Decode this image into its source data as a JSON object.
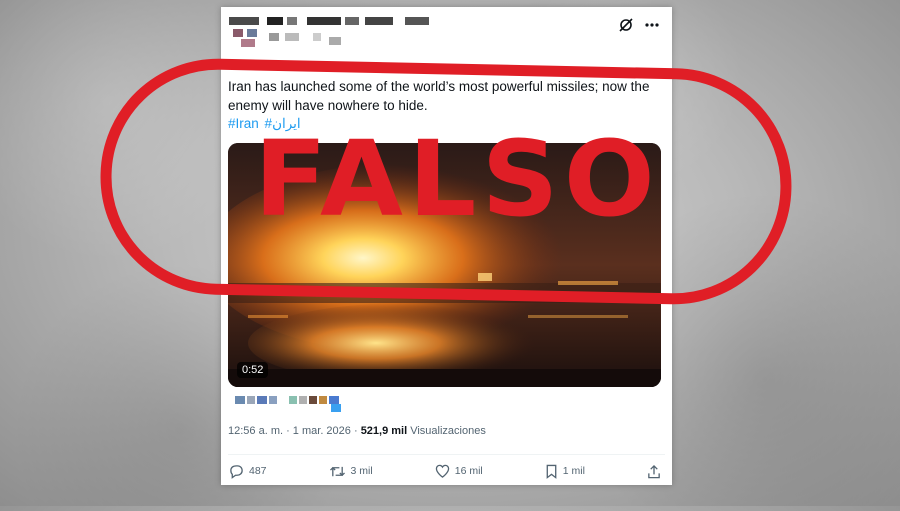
{
  "tweet": {
    "text": "Iran has launched some of the world’s most powerful missiles; now the enemy will have nowhere to hide.",
    "hashtags": [
      "#Iran",
      "#ایران"
    ],
    "video_duration": "0:52",
    "timestamp": "12:56 a. m. · 1 mar. 2026 · ",
    "views_count": "521,9 mil",
    "views_label": " Visualizaciones"
  },
  "actions": {
    "replies": "487",
    "reposts": "3 mil",
    "likes": "16 mil",
    "bookmarks": "1 mil"
  },
  "overlay": {
    "stamp_text": "FALSO",
    "stamp_color": "#e01e26"
  },
  "icons": [
    "grok-icon",
    "more-icon",
    "reply-icon",
    "repost-icon",
    "like-icon",
    "bookmark-icon",
    "share-icon"
  ]
}
